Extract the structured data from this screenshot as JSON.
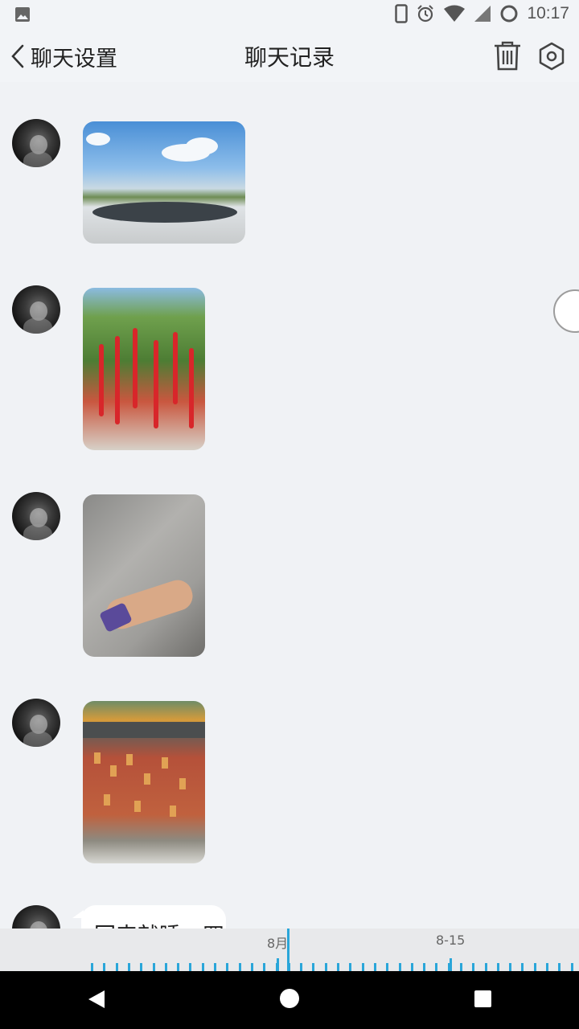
{
  "status_bar": {
    "time": "10:17",
    "icons": [
      "image-icon",
      "phone-icon",
      "alarm-icon",
      "wifi-icon",
      "signal-icon",
      "sync-circle-icon"
    ]
  },
  "header": {
    "back_label": "聊天设置",
    "title": "聊天记录",
    "icons": [
      "chevron-left-icon",
      "trash-icon",
      "settings-icon"
    ]
  },
  "messages": [
    {
      "type": "image",
      "subject": "fountain plaza"
    },
    {
      "type": "image",
      "subject": "tree with red ribbons"
    },
    {
      "type": "image",
      "subject": "arm with wristband on pavement"
    },
    {
      "type": "image",
      "subject": "wall of wishing tags"
    },
    {
      "type": "text",
      "text": "回来就睡一四"
    }
  ],
  "timeline": {
    "labels": [
      "8月",
      "8-15"
    ],
    "accent_color": "#2aa6d9"
  },
  "nav_bar": {
    "icons": [
      "nav-back-icon",
      "nav-home-icon",
      "nav-recents-icon"
    ]
  }
}
